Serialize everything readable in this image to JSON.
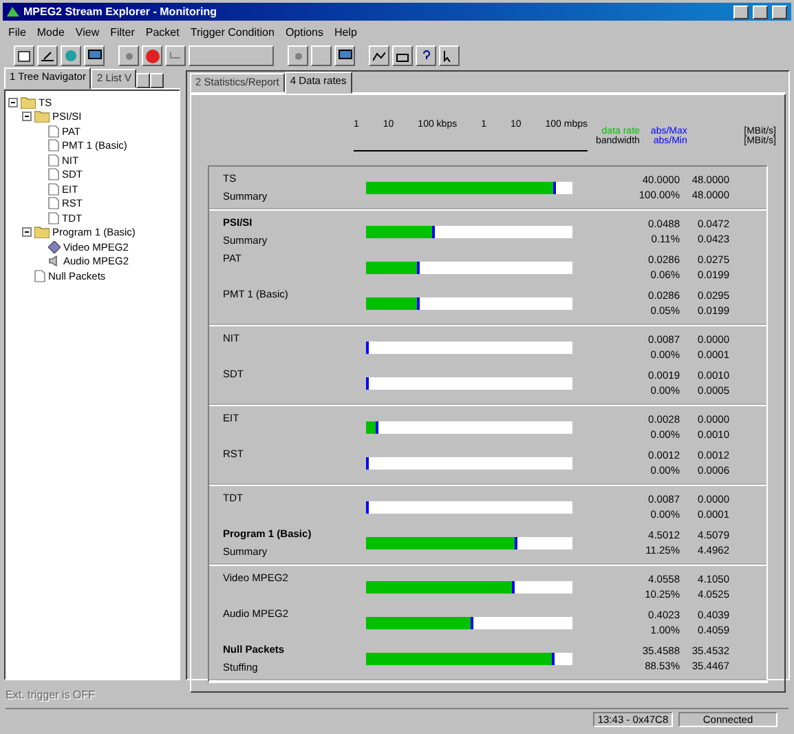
{
  "window": {
    "title": "MPEG2 Stream Explorer - Monitoring"
  },
  "menu": [
    "File",
    "Mode",
    "View",
    "Filter",
    "Packet",
    "Trigger Condition",
    "Options",
    "Help"
  ],
  "left_tabs": [
    {
      "label": "1 Tree Navigator",
      "selected": true
    },
    {
      "label": "2 List V",
      "selected": false
    }
  ],
  "tree": [
    {
      "label": "TS",
      "kind": "folder",
      "expanded": true,
      "children": [
        {
          "label": "PSI/SI",
          "kind": "folder",
          "expanded": true,
          "children": [
            {
              "label": "PAT",
              "kind": "file"
            },
            {
              "label": "PMT 1 (Basic)",
              "kind": "file"
            },
            {
              "label": "NIT",
              "kind": "file"
            },
            {
              "label": "SDT",
              "kind": "file"
            },
            {
              "label": "EIT",
              "kind": "file"
            },
            {
              "label": "RST",
              "kind": "file"
            },
            {
              "label": "TDT",
              "kind": "file"
            }
          ]
        },
        {
          "label": "Program 1 (Basic)",
          "kind": "folder",
          "expanded": true,
          "children": [
            {
              "label": "Video MPEG2",
              "kind": "video"
            },
            {
              "label": "Audio MPEG2",
              "kind": "audio"
            }
          ]
        },
        {
          "label": "Null Packets",
          "kind": "file"
        }
      ]
    }
  ],
  "right_tabs": [
    {
      "label": "2 Statistics/Report",
      "selected": false
    },
    {
      "label": "4 Data rates",
      "selected": true
    }
  ],
  "legend": {
    "scale": [
      "1",
      "10",
      "100 kbps",
      "1",
      "10",
      "100 mbps"
    ],
    "lines": [
      {
        "label": "data rate",
        "color": "#00c000",
        "stat": "abs/Max",
        "unit": "[MBit/s]"
      },
      {
        "label": "bandwidth",
        "color": "#000000",
        "stat": "abs/Min",
        "unit": "[MBit/s]"
      }
    ]
  },
  "groups": [
    [
      {
        "name": "TS",
        "sub": "Summary",
        "bold": false,
        "level": 0.92,
        "v": [
          "40.0000",
          "48.0000",
          "100.00%",
          "48.0000"
        ]
      }
    ],
    [
      {
        "name": "PSI/SI",
        "sub": "Summary",
        "bold": true,
        "level": 0.33,
        "v": [
          "0.0488",
          "0.0472",
          "0.11%",
          "0.0423"
        ]
      },
      {
        "name": "PAT",
        "bold": false,
        "level": 0.26,
        "v": [
          "0.0286",
          "0.0275",
          "0.06%",
          "0.0199"
        ]
      },
      {
        "name": "PMT 1 (Basic)",
        "bold": false,
        "level": 0.26,
        "v": [
          "0.0286",
          "0.0295",
          "0.05%",
          "0.0199"
        ]
      }
    ],
    [
      {
        "name": "NIT",
        "bold": false,
        "level": 0.006,
        "v": [
          "0.0087",
          "0.0000",
          "0.00%",
          "0.0001"
        ]
      },
      {
        "name": "SDT",
        "bold": false,
        "level": 0.006,
        "v": [
          "0.0019",
          "0.0010",
          "0.00%",
          "0.0005"
        ]
      }
    ],
    [
      {
        "name": "EIT",
        "bold": false,
        "level": 0.06,
        "v": [
          "0.0028",
          "0.0000",
          "0.00%",
          "0.0010"
        ]
      },
      {
        "name": "RST",
        "bold": false,
        "level": 0.01,
        "v": [
          "0.0012",
          "0.0012",
          "0.00%",
          "0.0006"
        ]
      }
    ],
    [
      {
        "name": "TDT",
        "bold": false,
        "level": 0.006,
        "v": [
          "0.0087",
          "0.0000",
          "0.00%",
          "0.0001"
        ]
      },
      {
        "name": "Program 1 (Basic)",
        "sub": "Summary",
        "bold": true,
        "level": 0.73,
        "v": [
          "4.5012",
          "4.5079",
          "11.25%",
          "4.4962"
        ]
      }
    ],
    [
      {
        "name": "Video MPEG2",
        "bold": false,
        "level": 0.72,
        "v": [
          "4.0558",
          "4.1050",
          "10.25%",
          "4.0525"
        ]
      },
      {
        "name": "Audio MPEG2",
        "bold": false,
        "level": 0.52,
        "v": [
          "0.4023",
          "0.4039",
          "1.00%",
          "0.4059"
        ]
      },
      {
        "name": "Null Packets",
        "sub": "Stuffing",
        "bold": true,
        "level": 0.91,
        "v": [
          "35.4588",
          "35.4532",
          "88.53%",
          "35.4467"
        ]
      }
    ]
  ],
  "status": {
    "hint": "Ext. trigger is OFF",
    "hint_disabled": true,
    "fields": [
      "13:43 - 0x47C8",
      "Connected"
    ]
  }
}
